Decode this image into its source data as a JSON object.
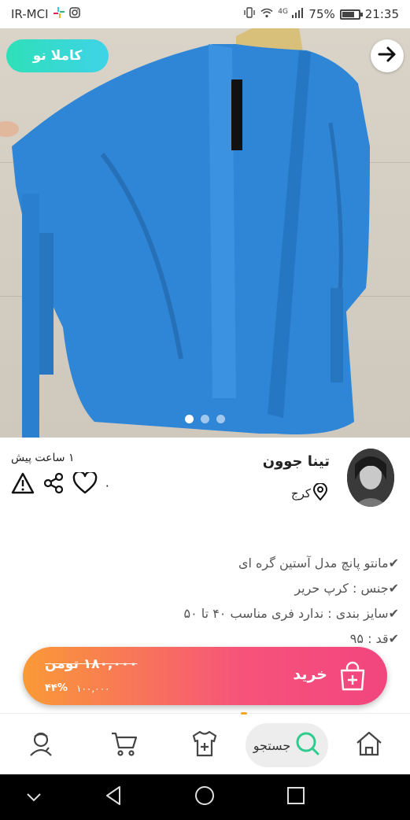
{
  "status_bar": {
    "carrier": "IR-MCI",
    "network": "4G",
    "battery": "75%",
    "battery_level": 0.75,
    "time": "21:35"
  },
  "hero": {
    "condition_badge": "کاملا نو",
    "image_count": 3,
    "active_image": 1
  },
  "seller": {
    "name": "تینا جوون",
    "location": "کرج",
    "posted_ago": "۱ ساعت پیش",
    "likes": "۰"
  },
  "description": [
    "✔مانتو پانچ مدل آستین گره ای",
    "✔جنس : کرپ حریر",
    "✔سایز بندی : ندارد فری مناسب ۴۰ تا ۵۰",
    "✔قد : ۹۵"
  ],
  "buy_bar": {
    "label": "خرید",
    "old_price": "۱۸۰,۰۰۰ تومن",
    "new_price": "۱۰۰,۰۰۰",
    "discount": "۴۴%"
  },
  "bottom_nav": {
    "search_label": "جستجو"
  },
  "colors": {
    "badge": "#2ee0b8",
    "buy_start": "#fa9a36",
    "buy_end": "#f2457f",
    "garment": "#2f86d6",
    "search_accent": "#2ecc8f",
    "nav_indicator": "#f5a623"
  },
  "icons": {
    "back": "arrow-right-icon",
    "report": "warning-icon",
    "share": "share-icon",
    "like": "heart-icon",
    "location": "location-pin-icon",
    "buy": "shopping-bag-icon",
    "nav": [
      "profile-icon",
      "cart-icon",
      "add-item-icon",
      "search-icon",
      "home-icon"
    ]
  }
}
